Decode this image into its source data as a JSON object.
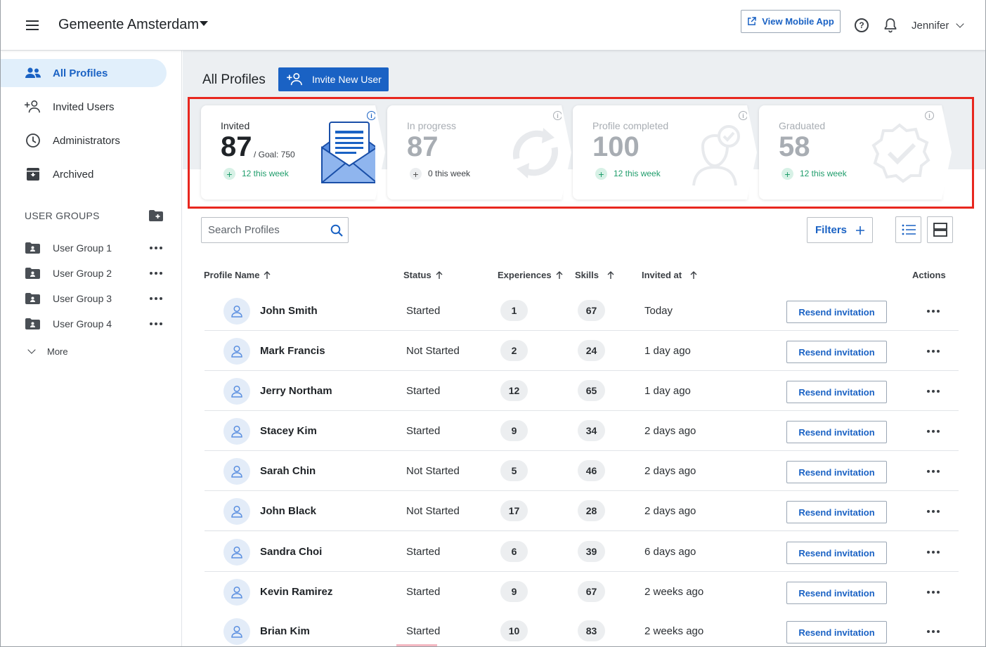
{
  "app": {
    "org_name": "Gemeente Amsterdam",
    "mobile_button": "View Mobile App",
    "help_symbol": "?",
    "user_name": "Jennifer"
  },
  "sidebar": {
    "items": [
      {
        "label": "All Profiles",
        "icon": "people-icon",
        "active": true
      },
      {
        "label": "Invited Users",
        "icon": "person-add-icon",
        "active": false
      },
      {
        "label": "Administrators",
        "icon": "clock-icon",
        "active": false
      },
      {
        "label": "Archived",
        "icon": "archive-icon",
        "active": false
      }
    ],
    "groups_title": "USER GROUPS",
    "groups": [
      {
        "label": "User Group 1"
      },
      {
        "label": "User Group 2"
      },
      {
        "label": "User Group 3"
      },
      {
        "label": "User Group 4"
      }
    ],
    "more_label": "More"
  },
  "main": {
    "title": "All Profiles",
    "invite_button": "Invite New User",
    "stats": [
      {
        "title": "Invited",
        "value": "87",
        "goal": "/ Goal: 750",
        "week": "12 this week",
        "illustration": "envelope-icon"
      },
      {
        "title": "In progress",
        "value": "87",
        "goal": "",
        "week": "0 this week",
        "illustration": "refresh-icon"
      },
      {
        "title": "Profile completed",
        "value": "100",
        "goal": "",
        "week": "12 this week",
        "illustration": "profile-check-icon"
      },
      {
        "title": "Graduated",
        "value": "58",
        "goal": "",
        "week": "12 this week",
        "illustration": "badge-check-icon"
      }
    ],
    "search_placeholder": "Search Profiles",
    "filters_label": "Filters",
    "columns": {
      "name": "Profile Name",
      "status": "Status",
      "experiences": "Experiences",
      "skills": "Skills",
      "invited_at": "Invited at",
      "actions": "Actions"
    },
    "resend_label": "Resend invitation",
    "rows": [
      {
        "name": "John Smith",
        "status": "Started",
        "experiences": "1",
        "skills": "67",
        "invited_at": "Today"
      },
      {
        "name": "Mark Francis",
        "status": "Not Started",
        "experiences": "2",
        "skills": "24",
        "invited_at": "1 day ago"
      },
      {
        "name": "Jerry Northam",
        "status": "Started",
        "experiences": "12",
        "skills": "65",
        "invited_at": "1 day ago"
      },
      {
        "name": "Stacey Kim",
        "status": "Started",
        "experiences": "9",
        "skills": "34",
        "invited_at": "2 days ago"
      },
      {
        "name": "Sarah Chin",
        "status": "Not Started",
        "experiences": "5",
        "skills": "46",
        "invited_at": "2 days ago"
      },
      {
        "name": "John Black",
        "status": "Not Started",
        "experiences": "17",
        "skills": "28",
        "invited_at": "2 days ago"
      },
      {
        "name": "Sandra Choi",
        "status": "Started",
        "experiences": "6",
        "skills": "39",
        "invited_at": "6 days ago"
      },
      {
        "name": "Kevin Ramirez",
        "status": "Started",
        "experiences": "9",
        "skills": "67",
        "invited_at": "2 weeks ago"
      },
      {
        "name": "Brian Kim",
        "status": "Started",
        "experiences": "10",
        "skills": "83",
        "invited_at": "2 weeks ago"
      }
    ]
  },
  "colors": {
    "accent": "#1a62c4",
    "success": "#1f9d6b",
    "highlight": "#e8271f"
  }
}
